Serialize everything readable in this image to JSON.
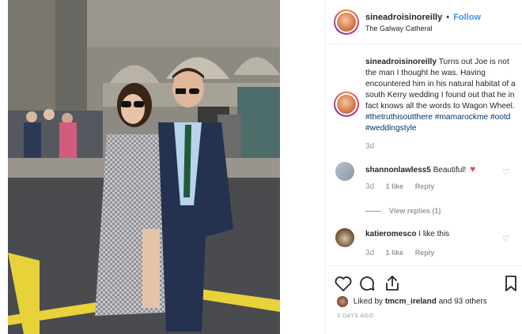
{
  "post": {
    "username": "sineadroisinoreilly",
    "follow_label": "Follow",
    "separator": "•",
    "location": "The Galway Catheral"
  },
  "caption": {
    "username": "sineadroisinoreilly",
    "text": "Turns out Joe is not the man I thought he was. Having encountered him in his natural habitat of a south Kerry wedding I found out that he in fact knows all the words to Wagon Wheel.",
    "hashtags": "#thetruthisoutthere #mamarockme #ootd #weddingstyle",
    "age": "3d"
  },
  "comments": [
    {
      "username": "shannonlawless5",
      "text": "Beautiful!",
      "emoji": "heart-emoji",
      "age": "3d",
      "likes": "1 like",
      "reply_label": "Reply"
    },
    {
      "username": "katieromesco",
      "text": "I like this",
      "age": "3d",
      "likes": "1 like",
      "reply_label": "Reply"
    }
  ],
  "view_replies_label": "View replies (1)",
  "actions": {
    "icons": [
      "heart-icon",
      "comment-icon",
      "share-icon",
      "bookmark-icon"
    ],
    "liked_prefix": "Liked by",
    "liked_user": "tmcm_ireland",
    "liked_suffix": "and 93 others",
    "timestamp": "3 DAYS AGO"
  },
  "colors": {
    "link_blue": "#3897f0",
    "hashtag_blue": "#003569",
    "heart_red": "#ed4956",
    "muted": "#999999"
  }
}
